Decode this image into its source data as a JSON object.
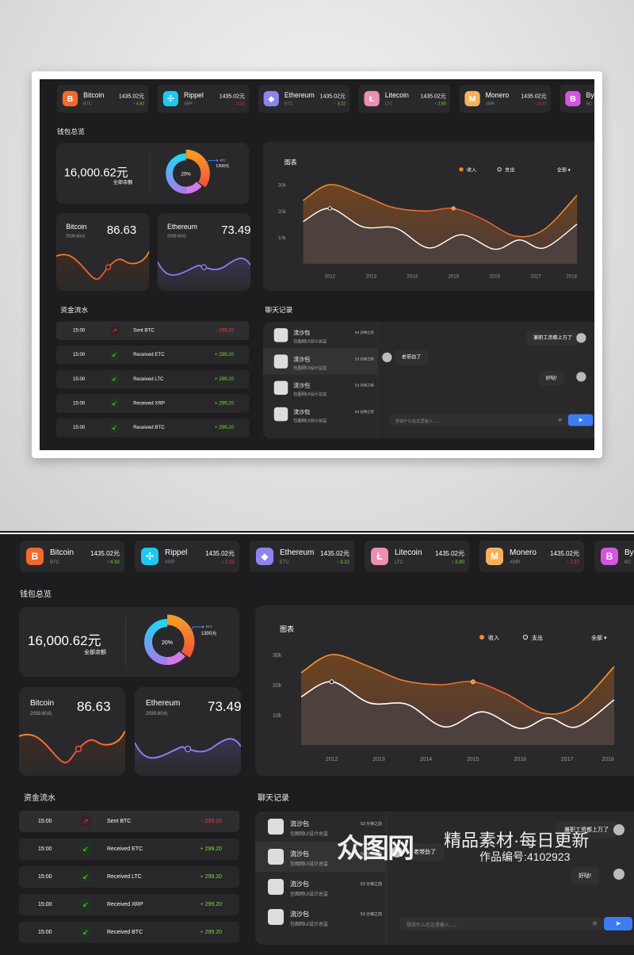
{
  "coins": [
    {
      "name": "Bitcoin",
      "ticker": "BTC",
      "price": "1435.02元",
      "change": "↑ 4.92",
      "up": true,
      "color": "#f26a2e",
      "glyph": "B"
    },
    {
      "name": "Rippel",
      "ticker": "XRP",
      "price": "1435.02元",
      "change": "↓ 3.32",
      "up": false,
      "color": "#1ec8f0",
      "glyph": "✣"
    },
    {
      "name": "Ethereum",
      "ticker": "ETC",
      "price": "1435.02元",
      "change": "↑ 3.22",
      "up": true,
      "color": "#8d84f0",
      "glyph": "◆"
    },
    {
      "name": "Litecoin",
      "ticker": "LTC",
      "price": "1435.02元",
      "change": "↑ 2.80",
      "up": true,
      "color": "#ee8fb0",
      "glyph": "Ł"
    },
    {
      "name": "Monero",
      "ticker": "XMR",
      "price": "1435.02元",
      "change": "↓ 2.37",
      "up": false,
      "color": "#f7b15a",
      "glyph": "M"
    },
    {
      "name": "By",
      "ticker": "BC",
      "price": "",
      "change": "",
      "up": true,
      "color": "#d455e0",
      "glyph": "B"
    }
  ],
  "colors": {
    "up": "#7ddc3a",
    "down": "#e0443a",
    "accent_orange": "#f5892a",
    "accent_purple": "#8e7cf0",
    "send": "#3d7cf0"
  },
  "wallet": {
    "title": "钱包总览",
    "balance": "16,000.62元",
    "balance_label": "全部余额",
    "donut_center": "20%",
    "donut_legend_label": "BTC",
    "donut_legend_value": "1300元",
    "donut_percent": 20
  },
  "mini": [
    {
      "name": "Bitcoin",
      "sub": "2939.60元",
      "value": "86.63"
    },
    {
      "name": "Ethereum",
      "sub": "2939.60元",
      "value": "73.49"
    }
  ],
  "chart": {
    "title": "图表",
    "legend_income": "收入",
    "legend_expense": "支出",
    "filter": "全部",
    "y_ticks": [
      "30k",
      "20k",
      "10k"
    ],
    "x_ticks": [
      "2012",
      "2013",
      "2014",
      "2015",
      "2016",
      "2017",
      "2018"
    ]
  },
  "chart_data": {
    "type": "area",
    "xlabel": "",
    "ylabel": "",
    "ylim": [
      0,
      36
    ],
    "x_range": [
      2011.35,
      2018
    ],
    "series": [
      {
        "name": "收入",
        "color": "#f5892a",
        "points": [
          [
            2011.35,
            24
          ],
          [
            2012,
            30
          ],
          [
            2012.8,
            26
          ],
          [
            2013.5,
            21.5
          ],
          [
            2014.3,
            20
          ],
          [
            2015,
            21
          ],
          [
            2015.7,
            17
          ],
          [
            2016.5,
            10.5
          ],
          [
            2017.2,
            13
          ],
          [
            2018,
            26
          ]
        ]
      },
      {
        "name": "支出",
        "color": "#ffffff",
        "points": [
          [
            2011.35,
            16
          ],
          [
            2012,
            21
          ],
          [
            2012.8,
            14
          ],
          [
            2013.6,
            13.5
          ],
          [
            2014.4,
            6
          ],
          [
            2015.2,
            11
          ],
          [
            2016,
            5.5
          ],
          [
            2016.6,
            9
          ],
          [
            2017.2,
            6
          ],
          [
            2018,
            15
          ]
        ]
      }
    ]
  },
  "flow": {
    "title": "资金流水",
    "rows": [
      {
        "time": "15:00",
        "label": "Sent BTC",
        "amount": "- 299.20",
        "sent": true
      },
      {
        "time": "15:00",
        "label": "Received ETC",
        "amount": "+ 299.20",
        "sent": false
      },
      {
        "time": "15:00",
        "label": "Received LTC",
        "amount": "+ 299.20",
        "sent": false
      },
      {
        "time": "15:00",
        "label": "Received XRP",
        "amount": "+ 299.20",
        "sent": false
      },
      {
        "time": "15:00",
        "label": "Received BTC",
        "amount": "+ 299.20",
        "sent": false
      }
    ]
  },
  "chat": {
    "title": "聊天记录",
    "contacts": [
      {
        "name": "流沙包",
        "role": "包图网UI设计总监",
        "time": "53 分钟之前"
      },
      {
        "name": "流沙包",
        "role": "包图网UI设计总监",
        "time": "53 分钟之前"
      },
      {
        "name": "流沙包",
        "role": "包图网UI设计总监",
        "time": "53 分钟之前"
      },
      {
        "name": "流沙包",
        "role": "包图网UI设计总监",
        "time": "53 分钟之前"
      }
    ],
    "messages": [
      "兼职工资都上万了",
      "老带劲了",
      "好哒!"
    ],
    "placeholder": "想说什么在这里输入......"
  },
  "watermark": {
    "brand": "众图网",
    "slogan": "精品素材·每日更新",
    "id": "作品编号:4102923"
  }
}
